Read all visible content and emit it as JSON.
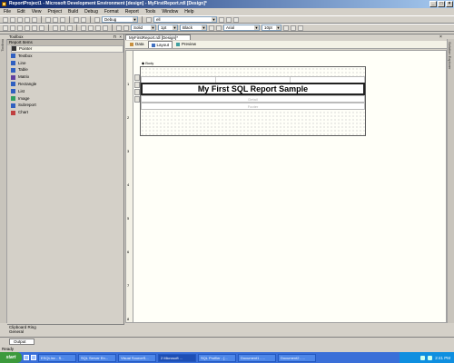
{
  "window": {
    "title": "ReportProject1 - Microsoft Development Environment [design] - MyFirstReport.rdl [Design]*",
    "controls": [
      "_",
      "□",
      "×"
    ]
  },
  "menu": [
    "File",
    "Edit",
    "View",
    "Project",
    "Build",
    "Debug",
    "Format",
    "Report",
    "Tools",
    "Window",
    "Help"
  ],
  "toolbar1": {
    "config_value": "Debug",
    "find_value": "ell"
  },
  "toolbar2": {
    "line_style": "Solid",
    "line_width": "1pt",
    "line_color": "Black",
    "font_name": "Arial",
    "font_size": "10pt"
  },
  "toolbox": {
    "title": "Toolbox",
    "side_label": "Toolbox",
    "category": "Report Items",
    "items": [
      {
        "label": "Pointer",
        "icon": "pointer-icon",
        "color": "#333333"
      },
      {
        "label": "Textbox",
        "icon": "textbox-icon",
        "color": "#3060c0"
      },
      {
        "label": "Line",
        "icon": "line-icon",
        "color": "#3060c0"
      },
      {
        "label": "Table",
        "icon": "table-icon",
        "color": "#3060c0"
      },
      {
        "label": "Matrix",
        "icon": "matrix-icon",
        "color": "#6040a0"
      },
      {
        "label": "Rectangle",
        "icon": "rectangle-icon",
        "color": "#3060c0"
      },
      {
        "label": "List",
        "icon": "list-icon",
        "color": "#3060c0"
      },
      {
        "label": "Image",
        "icon": "image-icon",
        "color": "#30a060"
      },
      {
        "label": "Subreport",
        "icon": "subreport-icon",
        "color": "#3060c0"
      },
      {
        "label": "Chart",
        "icon": "chart-icon",
        "color": "#c04040"
      }
    ],
    "clipboard_ring": "Clipboard Ring",
    "general": "General"
  },
  "document": {
    "tab_label": "MyFirstReport.rdl [Design]*",
    "subtabs": [
      {
        "label": "Data",
        "icon": "data-icon"
      },
      {
        "label": "Layout",
        "icon": "layout-icon"
      },
      {
        "label": "Preview",
        "icon": "preview-icon"
      }
    ],
    "active_subtab": "Layout"
  },
  "designer": {
    "body_label": "Body",
    "ruler_numbers": [
      "1",
      "2",
      "3",
      "4",
      "5",
      "6",
      "7",
      "8"
    ],
    "report_title": "My First SQL Report Sample",
    "detail_label": "Detail",
    "footer_label": "Footer"
  },
  "right_strip": {
    "label": "Solution Explorer"
  },
  "output": {
    "tab_label": "Output"
  },
  "status": {
    "text": "Ready"
  },
  "taskbar": {
    "start_label": "start",
    "tasks": [
      "ESQLInv - S...",
      "SQL Server En...",
      "Visual SourceS...",
      "2 Microsoft ...",
      "SQL Profiler - [...",
      "Document1 - ...",
      "Document2 - ..."
    ],
    "active_task_index": 3,
    "clock": "2:41 PM"
  }
}
